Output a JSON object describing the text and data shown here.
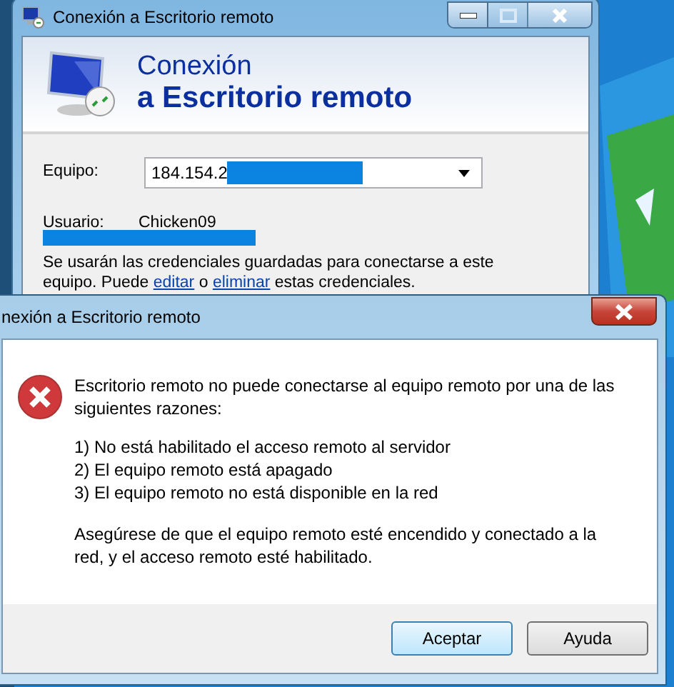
{
  "background_window": {
    "title": "Conexión a Escritorio remoto",
    "header": {
      "line_1": "Conexión",
      "line_2": "a Escritorio remoto"
    },
    "computer": {
      "label": "Equipo:",
      "value": "184.154.2"
    },
    "user": {
      "label": "Usuario:",
      "value": "Chicken09"
    },
    "credentials_note": {
      "before": "Se usarán las credenciales guardadas para conectarse a este equipo.  Puede ",
      "link_1": "editar",
      "middle": " o ",
      "link_2": "eliminar",
      "after": " estas credenciales."
    }
  },
  "error_dialog": {
    "title": "nexión a Escritorio remoto",
    "message": "Escritorio remoto no puede conectarse al equipo remoto por una de las siguientes razones:",
    "reasons": [
      "1) No está habilitado el acceso remoto al servidor",
      "2) El equipo remoto está apagado",
      "3) El equipo remoto no está disponible en la red"
    ],
    "advice": "Asegúrese de que el equipo remoto esté encendido y conectado a la red, y el acceso remoto esté habilitado.",
    "buttons": [
      {
        "label": "Aceptar",
        "default": true
      },
      {
        "label": "Ayuda",
        "default": false
      }
    ]
  }
}
